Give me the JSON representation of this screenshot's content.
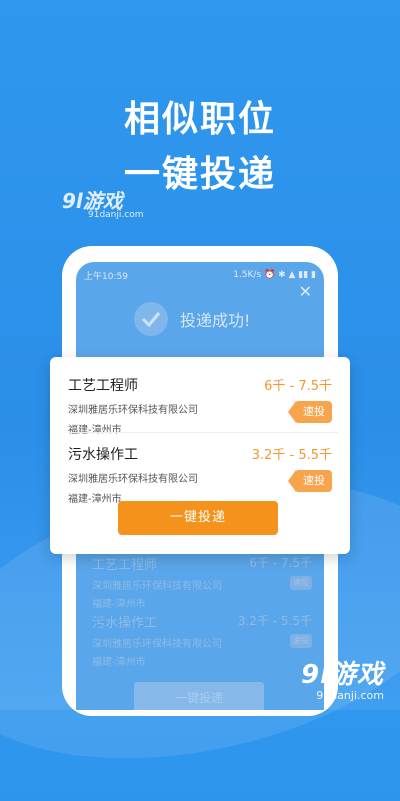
{
  "headline": {
    "line1": "相似职位",
    "line2": "一键投递"
  },
  "watermark_top": {
    "logo": "9l游戏",
    "url": "91danji.com"
  },
  "watermark_bottom": {
    "logo": "9l游戏",
    "url": "91danji.com"
  },
  "status_bar": {
    "time": "上午10:59",
    "indicators": "1.5K/s ⏰ ✱ ▲ ▮▮ ▮"
  },
  "dialog_bg": {
    "success_text": "投递成功!",
    "jobs": [
      {
        "title": "工艺工程师",
        "salary": "6千 - 7.5千",
        "company": "深圳雅居乐环保科技有限公司",
        "location": "福建-漳州市",
        "action": "速投"
      },
      {
        "title": "污水操作工",
        "salary": "3.2千 - 5.5千",
        "company": "深圳雅居乐环保科技有限公司",
        "location": "福建-漳州市",
        "action": "速投"
      }
    ],
    "apply_all": "一键投递"
  },
  "card": {
    "jobs": [
      {
        "title": "工艺工程师",
        "salary": "6千 - 7.5千",
        "company": "深圳雅居乐环保科技有限公司",
        "location": "福建-漳州市",
        "action": "速投"
      },
      {
        "title": "污水操作工",
        "salary": "3.2千 - 5.5千",
        "company": "深圳雅居乐环保科技有限公司",
        "location": "福建-漳州市",
        "action": "速投"
      }
    ],
    "apply_all": "一键投递"
  },
  "colors": {
    "background": "#2f97ee",
    "accent": "#f5921c",
    "salary": "#f19a2b",
    "tag": "#f7a54d"
  },
  "icons": {
    "close": "close-icon",
    "success": "check-circle-icon"
  }
}
